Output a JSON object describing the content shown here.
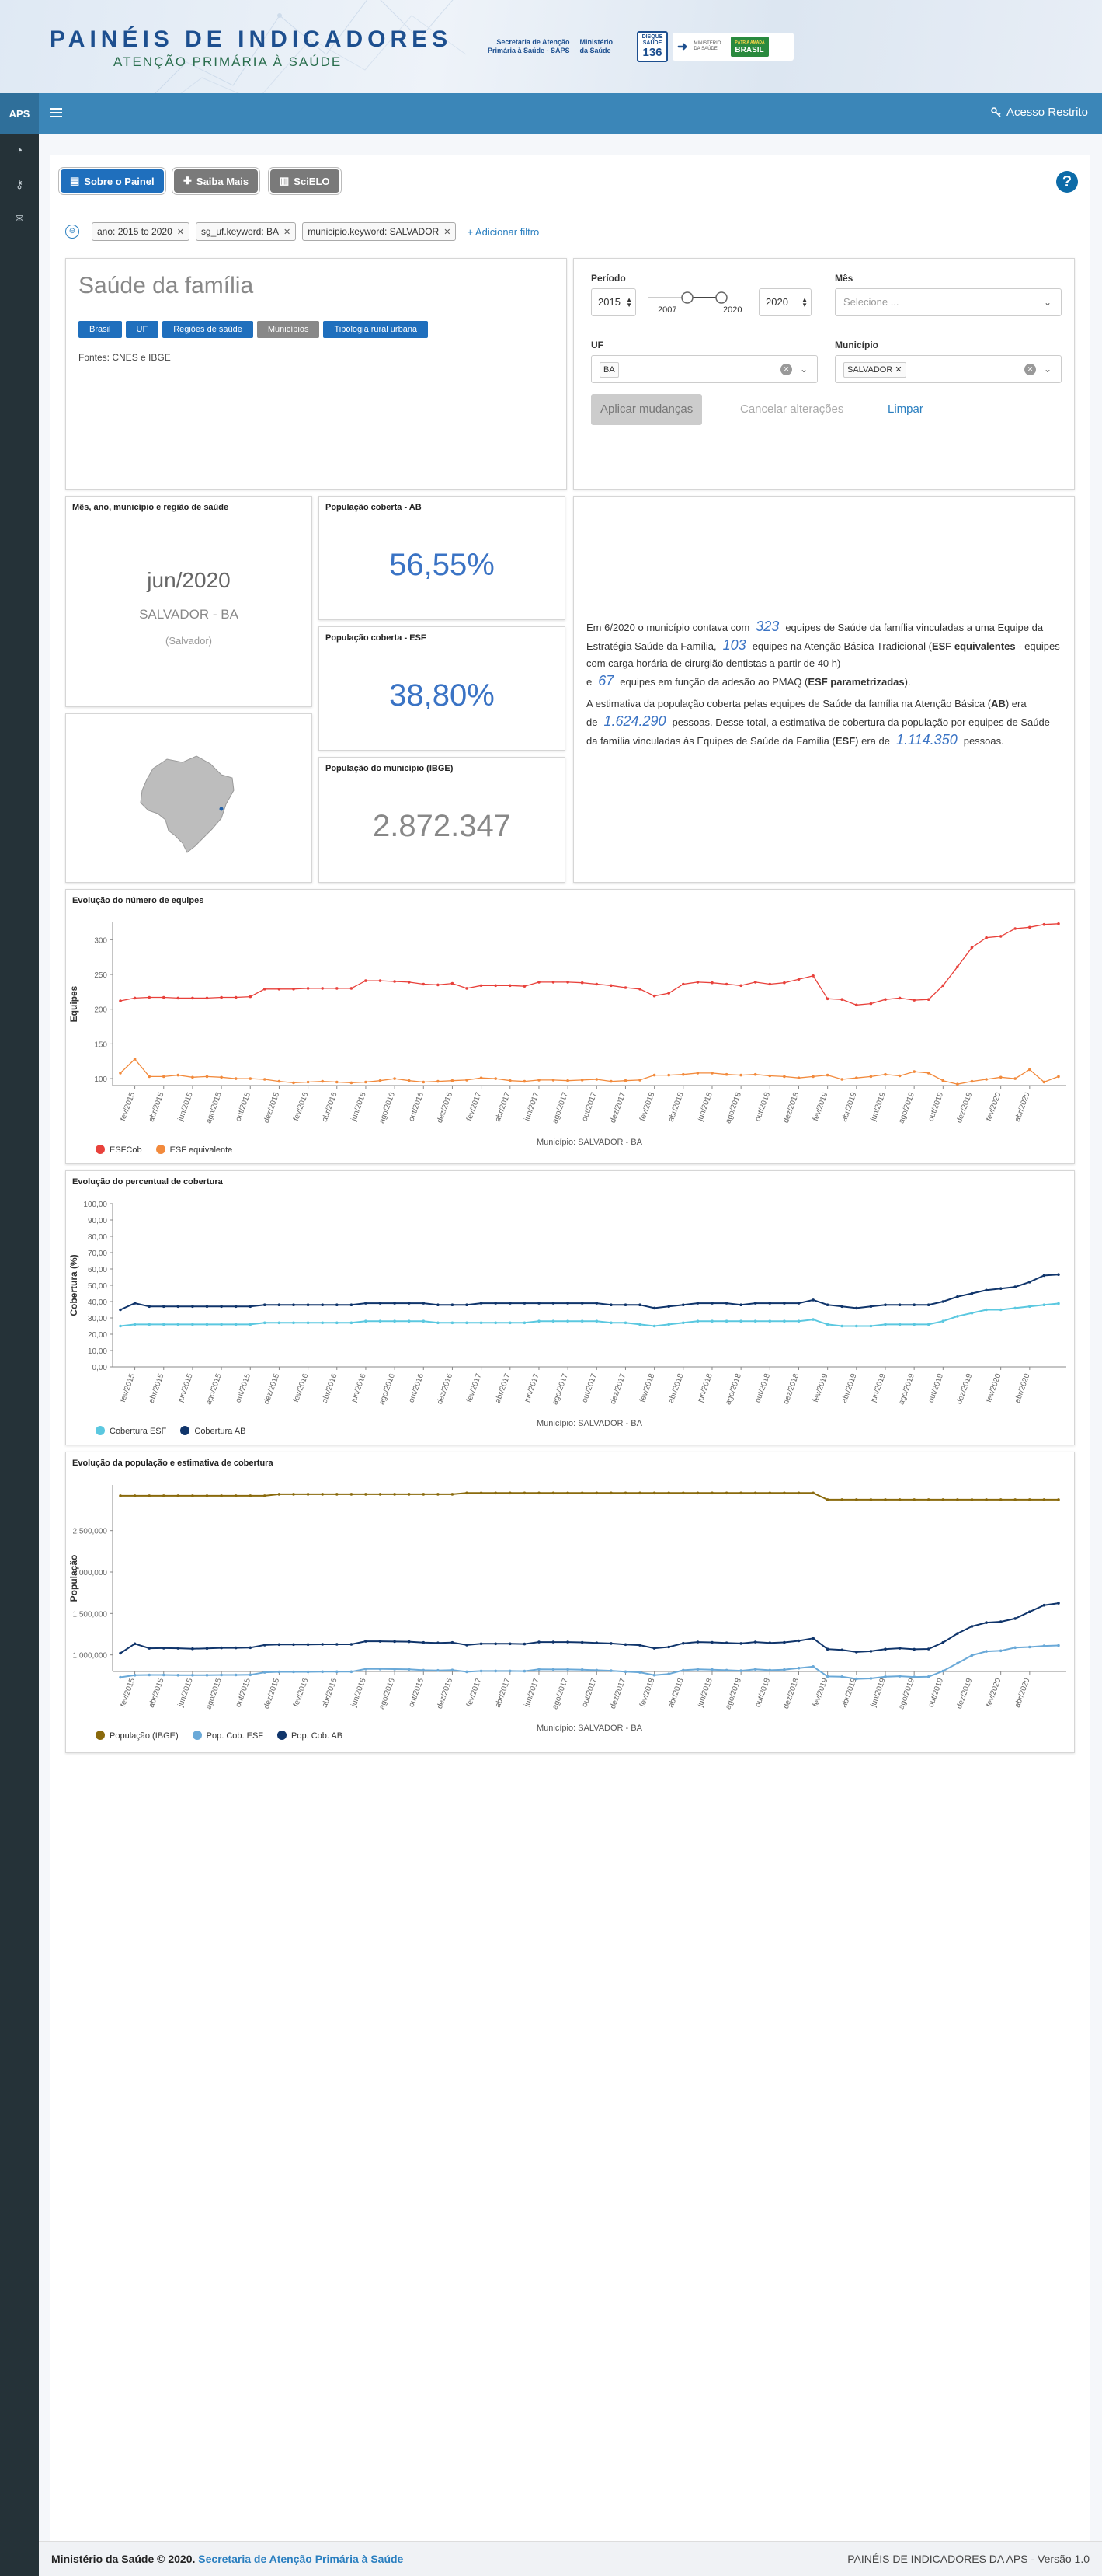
{
  "header": {
    "title": "PAINÉIS DE INDICADORES",
    "subtitle": "ATENÇÃO PRIMÁRIA À SAÚDE",
    "saps_line1": "Secretaria de Atenção",
    "saps_line2": "Primária à Saúde - SAPS",
    "ministerio_line1": "Ministério",
    "ministerio_line2": "da Saúde",
    "disque_top": "DISQUE SAÚDE",
    "disque_num": "136",
    "gov_ministerio": "MINISTÉRIO DA SAÚDE",
    "gov_brasil": "BRASIL",
    "gov_patria": "PÁTRIA AMADA"
  },
  "nav": {
    "aps": "APS",
    "acesso": "Acesso Restrito"
  },
  "toolbar": {
    "sobre": "Sobre o Painel",
    "saiba": "Saiba Mais",
    "scielo": "SciELO",
    "help": "?"
  },
  "filters": {
    "pills": [
      "ano: 2015 to 2020",
      "sg_uf.keyword: BA",
      "municipio.keyword: SALVADOR"
    ],
    "add": "+ Adicionar filtro"
  },
  "intro": {
    "title": "Saúde da família",
    "buttons": [
      "Brasil",
      "UF",
      "Regiões de saúde",
      "Municípios",
      "Tipologia rural urbana"
    ],
    "active": "Municípios",
    "fontes": "Fontes: CNES e IBGE"
  },
  "controls": {
    "periodo_label": "Período",
    "ano_inicio": "2015",
    "ano_fim": "2020",
    "slider_min": "2007",
    "slider_max": "2020",
    "mes_label": "Mês",
    "mes_placeholder": "Selecione ...",
    "uf_label": "UF",
    "uf_value": "BA",
    "municipio_label": "Município",
    "municipio_value": "SALVADOR",
    "apply": "Aplicar mudanças",
    "cancel": "Cancelar alterações",
    "clear": "Limpar"
  },
  "info_card": {
    "title": "Mês, ano, município e região de saúde",
    "date": "jun/2020",
    "municipio": "SALVADOR - BA",
    "regiao": "(Salvador)"
  },
  "kpis": {
    "ab_title": "População coberta - AB",
    "ab_value": "56,55%",
    "esf_title": "População coberta - ESF",
    "esf_value": "38,80%",
    "pop_title": "População do município (IBGE)",
    "pop_value": "2.872.347"
  },
  "description": {
    "p1_a": "Em 6/2020 o município contava com",
    "n_esf": "323",
    "p1_b": "equipes de Saúde da família vinculadas a uma Equipe da Estratégia Saúde da Família,",
    "n_ab": "103",
    "p1_c": "equipes na Atenção Básica Tradicional (",
    "p1_c_bold": "ESF equivalentes",
    "p1_d": " - equipes com carga horária de cirurgião dentistas a partir de 40 h)",
    "p1_e": "e",
    "n_param": "67",
    "p1_f": "equipes em função da adesão ao PMAQ (",
    "p1_f_bold": "ESF parametrizadas",
    "p1_g": ").",
    "p2_a": "A estimativa da população coberta pelas equipes de Saúde da família na Atenção Básica (",
    "p2_a_bold": "AB",
    "p2_b": ") era de",
    "n_pop_ab": "1.624.290",
    "p2_c": "pessoas. Desse total, a estimativa de cobertura da população por equipes de Saúde da família vinculadas às Equipes de Saúde da Família (",
    "p2_c_bold": "ESF",
    "p2_d": ") era de",
    "n_pop_esf": "1.114.350",
    "p2_e": "pessoas."
  },
  "colors": {
    "esfcob": "#e8413b",
    "esf_equiv": "#f28a3c",
    "cob_esf": "#5bc8e0",
    "cob_ab": "#10356b",
    "pop_ibge": "#8a6a0c",
    "pop_esf": "#6aa9d8",
    "pop_ab": "#10356b"
  },
  "chart_data": [
    {
      "type": "line",
      "title": "Evolução do número de equipes",
      "xlabel": "Município: SALVADOR - BA",
      "ylabel": "Equipes",
      "ylim": [
        90,
        325
      ],
      "yticks": [
        100,
        150,
        200,
        250,
        300
      ],
      "xticks": [
        "fev/2015",
        "abr/2015",
        "jun/2015",
        "ago/2015",
        "out/2015",
        "dez/2015",
        "fev/2016",
        "abr/2016",
        "jun/2016",
        "ago/2016",
        "out/2016",
        "dez/2016",
        "fev/2017",
        "abr/2017",
        "jun/2017",
        "ago/2017",
        "out/2017",
        "dez/2017",
        "fev/2018",
        "abr/2018",
        "jun/2018",
        "ago/2018",
        "out/2018",
        "dez/2018",
        "fev/2019",
        "abr/2019",
        "jun/2019",
        "ago/2019",
        "out/2019",
        "dez/2019",
        "fev/2020",
        "abr/2020"
      ],
      "series": [
        {
          "name": "ESFCob",
          "values": [
            212,
            216,
            217,
            217,
            216,
            216,
            216,
            217,
            217,
            218,
            229,
            229,
            229,
            230,
            230,
            230,
            230,
            241,
            241,
            240,
            239,
            236,
            235,
            237,
            230,
            234,
            234,
            234,
            233,
            239,
            239,
            239,
            238,
            236,
            234,
            231,
            229,
            219,
            223,
            236,
            239,
            238,
            236,
            234,
            239,
            236,
            238,
            243,
            248,
            215,
            214,
            206,
            208,
            214,
            216,
            213,
            214,
            234,
            261,
            289,
            303,
            305,
            316,
            318,
            322,
            323
          ]
        },
        {
          "name": "ESF equivalente",
          "values": [
            108,
            128,
            103,
            103,
            105,
            102,
            103,
            102,
            100,
            100,
            99,
            96,
            94,
            95,
            96,
            95,
            94,
            95,
            97,
            100,
            97,
            95,
            96,
            97,
            98,
            101,
            100,
            97,
            96,
            98,
            98,
            97,
            98,
            99,
            96,
            97,
            98,
            105,
            105,
            106,
            108,
            108,
            106,
            105,
            106,
            104,
            103,
            101,
            103,
            105,
            99,
            101,
            103,
            106,
            104,
            110,
            108,
            97,
            92,
            96,
            99,
            102,
            100,
            113,
            95,
            103
          ]
        }
      ]
    },
    {
      "type": "line",
      "title": "Evolução do percentual de cobertura",
      "xlabel": "Município: SALVADOR - BA",
      "ylabel": "Cobertura (%)",
      "ylim": [
        0,
        100
      ],
      "yticks": [
        "0,00",
        "10,00",
        "20,00",
        "30,00",
        "40,00",
        "50,00",
        "60,00",
        "70,00",
        "80,00",
        "90,00",
        "100,00"
      ],
      "xticks": [
        "fev/2015",
        "abr/2015",
        "jun/2015",
        "ago/2015",
        "out/2015",
        "dez/2015",
        "fev/2016",
        "abr/2016",
        "jun/2016",
        "ago/2016",
        "out/2016",
        "dez/2016",
        "fev/2017",
        "abr/2017",
        "jun/2017",
        "ago/2017",
        "out/2017",
        "dez/2017",
        "fev/2018",
        "abr/2018",
        "jun/2018",
        "ago/2018",
        "out/2018",
        "dez/2018",
        "fev/2019",
        "abr/2019",
        "jun/2019",
        "ago/2019",
        "out/2019",
        "dez/2019",
        "fev/2020",
        "abr/2020"
      ],
      "series": [
        {
          "name": "Cobertura ESF",
          "values": [
            25,
            26,
            26,
            26,
            26,
            26,
            26,
            26,
            26,
            26,
            27,
            27,
            27,
            27,
            27,
            27,
            27,
            28,
            28,
            28,
            28,
            28,
            27,
            27,
            27,
            27,
            27,
            27,
            27,
            28,
            28,
            28,
            28,
            28,
            27,
            27,
            26,
            25,
            26,
            27,
            28,
            28,
            28,
            28,
            28,
            28,
            28,
            28,
            29,
            26,
            25,
            25,
            25,
            26,
            26,
            26,
            26,
            28,
            31,
            33,
            35,
            35,
            36,
            37,
            38,
            38.8
          ]
        },
        {
          "name": "Cobertura AB",
          "values": [
            35,
            39,
            37,
            37,
            37,
            37,
            37,
            37,
            37,
            37,
            38,
            38,
            38,
            38,
            38,
            38,
            38,
            39,
            39,
            39,
            39,
            39,
            38,
            38,
            38,
            39,
            39,
            39,
            39,
            39,
            39,
            39,
            39,
            39,
            38,
            38,
            38,
            36,
            37,
            38,
            39,
            39,
            39,
            38,
            39,
            39,
            39,
            39,
            41,
            38,
            37,
            36,
            37,
            38,
            38,
            38,
            38,
            40,
            43,
            45,
            47,
            48,
            49,
            52,
            56,
            56.55
          ]
        }
      ]
    },
    {
      "type": "line",
      "title": "Evolução da população e estimativa de cobertura",
      "xlabel": "Município: SALVADOR - BA",
      "ylabel": "População",
      "ylim": [
        800000,
        3050000
      ],
      "yticks": [
        "1,000,000",
        "1,500,000",
        "2,000,000",
        "2,500,000"
      ],
      "xticks": [
        "fev/2015",
        "abr/2015",
        "jun/2015",
        "ago/2015",
        "out/2015",
        "dez/2015",
        "fev/2016",
        "abr/2016",
        "jun/2016",
        "ago/2016",
        "out/2016",
        "dez/2016",
        "fev/2017",
        "abr/2017",
        "jun/2017",
        "ago/2017",
        "out/2017",
        "dez/2017",
        "fev/2018",
        "abr/2018",
        "jun/2018",
        "ago/2018",
        "out/2018",
        "dez/2018",
        "fev/2019",
        "abr/2019",
        "jun/2019",
        "ago/2019",
        "out/2019",
        "dez/2019",
        "fev/2020",
        "abr/2020"
      ],
      "series": [
        {
          "name": "População (IBGE)",
          "values": [
            2920000,
            2920000,
            2920000,
            2920000,
            2920000,
            2920000,
            2920000,
            2920000,
            2920000,
            2920000,
            2920000,
            2938000,
            2938000,
            2938000,
            2938000,
            2938000,
            2938000,
            2938000,
            2938000,
            2938000,
            2938000,
            2938000,
            2938000,
            2938000,
            2953000,
            2953000,
            2953000,
            2953000,
            2953000,
            2953000,
            2953000,
            2953000,
            2953000,
            2953000,
            2953000,
            2953000,
            2953000,
            2953000,
            2953000,
            2953000,
            2953000,
            2953000,
            2953000,
            2953000,
            2953000,
            2953000,
            2953000,
            2953000,
            2953000,
            2872347,
            2872347,
            2872347,
            2872347,
            2872347,
            2872347,
            2872347,
            2872347,
            2872347,
            2872347,
            2872347,
            2872347,
            2872347,
            2872347,
            2872347,
            2872347,
            2872347
          ]
        },
        {
          "name": "Pop. Cob. ESF",
          "values": [
            730000,
            755000,
            758000,
            758000,
            755000,
            755000,
            755000,
            758000,
            758000,
            760000,
            790000,
            795000,
            795000,
            795000,
            797000,
            797000,
            797000,
            830000,
            830000,
            828000,
            825000,
            815000,
            812000,
            817000,
            796000,
            806000,
            806000,
            806000,
            804000,
            825000,
            824000,
            824000,
            822000,
            815000,
            808000,
            797000,
            790000,
            756000,
            770000,
            815000,
            825000,
            822000,
            815000,
            808000,
            825000,
            815000,
            822000,
            840000,
            858000,
            740000,
            736000,
            710000,
            716000,
            736000,
            743000,
            733000,
            736000,
            805000,
            898000,
            995000,
            1043000,
            1050000,
            1088000,
            1095000,
            1108000,
            1114350
          ]
        },
        {
          "name": "Pop. Cob. AB",
          "values": [
            1020000,
            1135000,
            1080000,
            1082000,
            1080000,
            1075000,
            1078000,
            1085000,
            1085000,
            1088000,
            1120000,
            1125000,
            1125000,
            1125000,
            1128000,
            1128000,
            1128000,
            1165000,
            1165000,
            1162000,
            1160000,
            1150000,
            1145000,
            1150000,
            1120000,
            1135000,
            1135000,
            1135000,
            1132000,
            1155000,
            1155000,
            1155000,
            1152000,
            1145000,
            1138000,
            1125000,
            1118000,
            1080000,
            1095000,
            1140000,
            1155000,
            1152000,
            1145000,
            1138000,
            1155000,
            1145000,
            1152000,
            1170000,
            1200000,
            1070000,
            1060000,
            1035000,
            1045000,
            1070000,
            1080000,
            1068000,
            1072000,
            1150000,
            1258000,
            1345000,
            1390000,
            1400000,
            1438000,
            1520000,
            1600000,
            1624290
          ]
        }
      ]
    }
  ],
  "footer": {
    "left_bold": "Ministério da Saúde © 2020.",
    "left_link": "Secretaria de Atenção Primária à Saúde",
    "right": "PAINÉIS DE INDICADORES DA APS - Versão 1.0"
  }
}
